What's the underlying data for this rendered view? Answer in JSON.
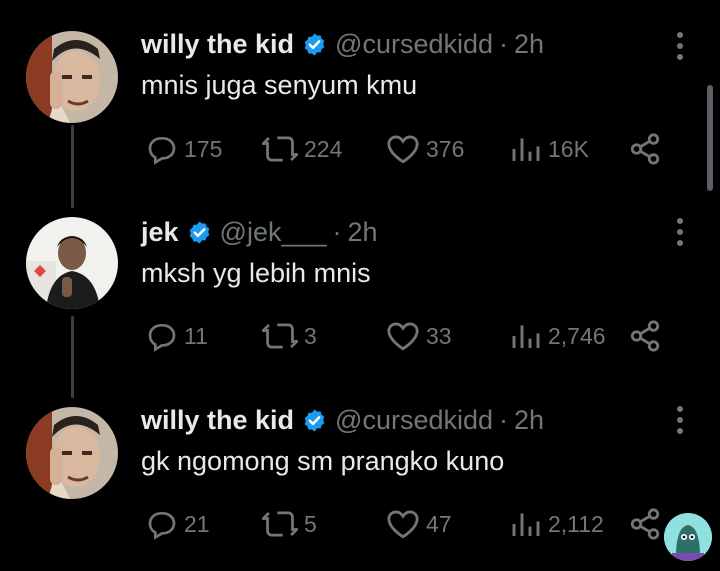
{
  "tweets": [
    {
      "author": {
        "name": "willy the kid",
        "handle": "@cursedkidd",
        "verified": true
      },
      "time": "2h",
      "text": "mnis juga senyum kmu",
      "stats": {
        "replies": "175",
        "retweets": "224",
        "likes": "376",
        "views": "16K"
      }
    },
    {
      "author": {
        "name": "jek",
        "handle": "@jek___",
        "verified": true
      },
      "time": "2h",
      "text": "mksh yg lebih mnis",
      "stats": {
        "replies": "11",
        "retweets": "3",
        "likes": "33",
        "views": "2,746"
      }
    },
    {
      "author": {
        "name": "willy the kid",
        "handle": "@cursedkidd",
        "verified": true
      },
      "time": "2h",
      "text": "gk ngomong sm prangko kuno",
      "stats": {
        "replies": "21",
        "retweets": "5",
        "likes": "47",
        "views": "2,112"
      }
    }
  ],
  "separator": "·",
  "colors": {
    "background": "#000000",
    "text": "#e7e9ea",
    "muted": "#71767b",
    "verified": "#1d9bf0",
    "thread_line": "#3a3f44"
  },
  "icons": [
    "reply-icon",
    "retweet-icon",
    "like-icon",
    "views-icon",
    "share-icon",
    "more-icon",
    "verified-badge-icon"
  ]
}
